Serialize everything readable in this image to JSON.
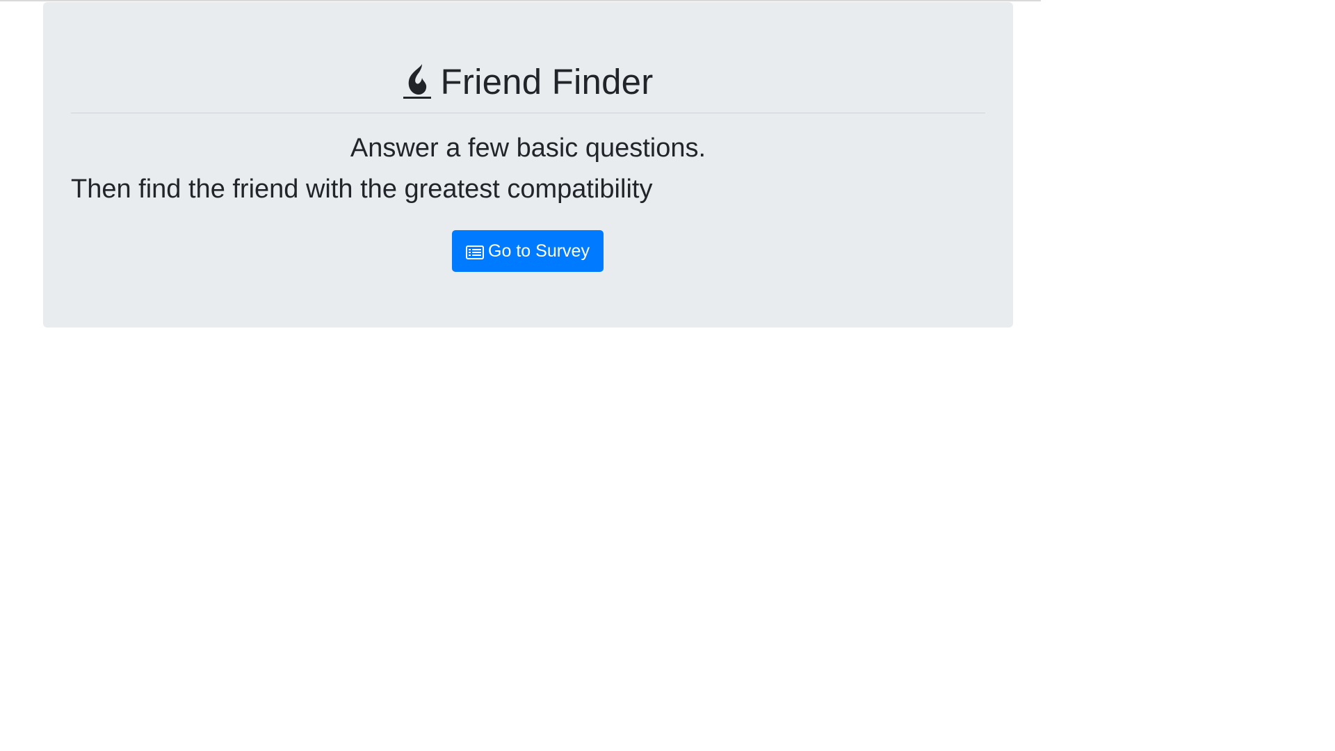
{
  "page": {
    "title": "Friend Finder",
    "title_icon": "fire-icon",
    "lead_line_1": "Answer a few basic questions.",
    "lead_line_2": "Then find the friend with the greatest compatibility"
  },
  "actions": {
    "survey_button_label": "Go to Survey",
    "survey_button_icon": "list-alt-icon"
  },
  "colors": {
    "jumbotron_background": "#e9ecef",
    "primary_button": "#007bff",
    "text": "#212529"
  }
}
